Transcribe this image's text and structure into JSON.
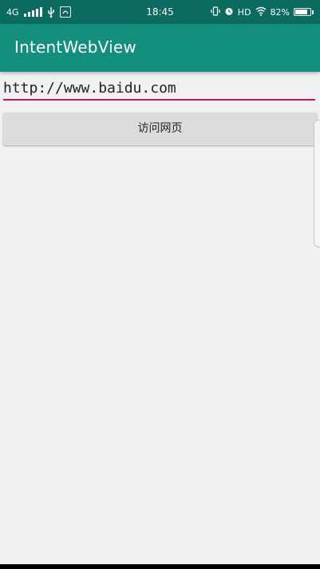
{
  "status_bar": {
    "network_type": "4G",
    "time": "18:45",
    "hd": "HD",
    "battery_percent": "82%",
    "battery_level": 0.82,
    "icons": [
      "signal-icon",
      "usb-icon",
      "app-notification-icon",
      "vibrate-icon",
      "alarm-icon",
      "wifi-icon",
      "battery-charging-icon"
    ]
  },
  "app_bar": {
    "title": "IntentWebView",
    "color": "#128f7d",
    "status_color": "#0c6b5f"
  },
  "url_field": {
    "value": "http://www.baidu.com",
    "underline_color": "#c2185b"
  },
  "visit_button": {
    "label": "访问网页"
  }
}
